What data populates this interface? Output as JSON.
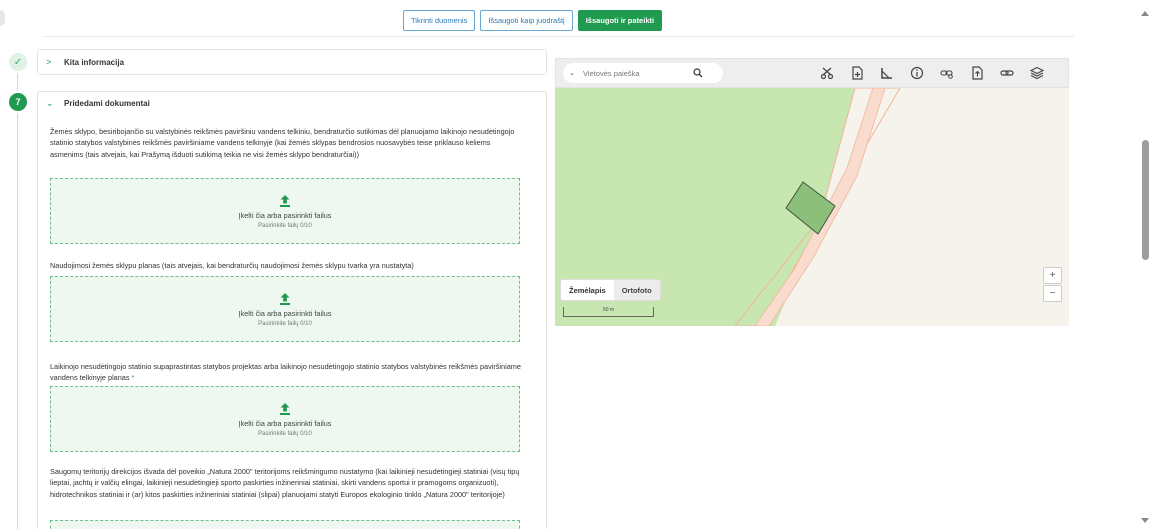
{
  "toolbar": {
    "check_label": "Tikrinti duomenis",
    "draft_label": "Išsaugoti kaip juodraštį",
    "submit_label": "Išsaugoti ir pateikti"
  },
  "sections": {
    "other": {
      "title": "Kita informacija"
    },
    "docs": {
      "step": "7",
      "title": "Pridedami dokumentai"
    }
  },
  "documents": [
    {
      "label": "Žemės sklypo, besiribojančio su valstybinės reikšmės paviršiniu vandens telkiniu, bendraturčio sutikimas dėl planuojamo laikinojo nesudėtingojo statinio statybos valstybinės reikšmės paviršiniame vandens telkinyje (kai žemės sklypas bendrosios nuosavybės teise priklauso keliems asmenims (tais atvejais, kai Prašymą išduoti sutikimą teikia ne visi žemės sklypo bendraturčiai))",
      "required": false
    },
    {
      "label": "Naudojimosi žemės sklypu planas (tais atvejais, kai bendraturčių naudojimosi žemės sklypu tvarka yra nustatyta)",
      "required": false
    },
    {
      "label": "Laikinojo nesudėtingojo statinio supaprastintas statybos projektas arba laikinojo nesudėtingojo statinio statybos valstybinės reikšmės paviršiniame vandens telkinyje planas",
      "required": true
    },
    {
      "label": "Saugomų teritorijų direkcijos išvada dėl poveikio „Natura 2000\" teritorijoms reikšmingumo nustatymo (kai laikinieji nesudėtingieji statiniai (visų tipų lieptai, jachtų ir valčių elingai, laikinieji nesudėtingieji sporto paskirties inžineriniai statiniai, skirti vandens sportui ir pramogoms organizuoti), hidrotechnikos statiniai ir (ar) kitos paskirties inžineriniai statiniai (slipai) planuojami statyti Europos ekologinio tinklo „Natura 2000\" teritorijoje)",
      "required": false
    }
  ],
  "dropzone": {
    "text": "Įkelti čia arba pasirinkti failus",
    "sub": "Pasirinkite failų 0/10",
    "required_mark": "*"
  },
  "map": {
    "search_placeholder": "Vietovės paieška",
    "tabs": [
      "Žemėlapis",
      "Ortofoto"
    ],
    "scale_label": "50 m",
    "zoom_in": "+",
    "zoom_out": "−",
    "tools": [
      "scissors-icon",
      "file-add-icon",
      "measure-area-icon",
      "info-icon",
      "link-search-icon",
      "file-export-icon",
      "link-icon",
      "layers-icon"
    ],
    "colors": {
      "land": "#c8e6b0",
      "bg": "#f5f3ec",
      "parcel": "#8cbf7a",
      "road": "#f2b49a"
    }
  }
}
